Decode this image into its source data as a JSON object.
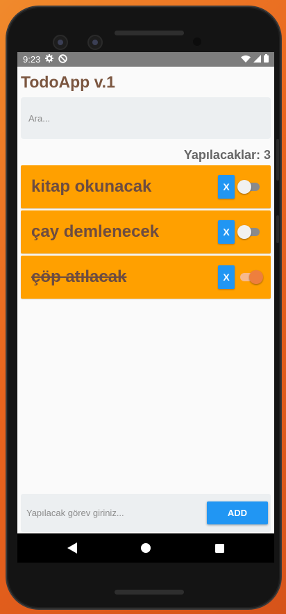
{
  "app": {
    "title": "TodoApp v.1",
    "search_placeholder": "Ara...",
    "count_label": "Yapılacaklar: 3"
  },
  "status_bar": {
    "time": "9:23"
  },
  "todos": [
    {
      "text": "kitap okunacak",
      "done": false,
      "delete_label": "X"
    },
    {
      "text": "çay demlenecek",
      "done": false,
      "delete_label": "X"
    },
    {
      "text": "çöp atılacak",
      "done": true,
      "delete_label": "X"
    }
  ],
  "add_bar": {
    "placeholder": "Yapılacak görev giriniz...",
    "button_label": "ADD"
  },
  "colors": {
    "accent": "#ffa000",
    "button": "#2196f3",
    "title": "#7b5640"
  },
  "icons": [
    "settings-icon",
    "do-not-disturb-icon",
    "wifi-icon",
    "signal-icon",
    "battery-icon",
    "back-icon",
    "home-icon",
    "recents-icon"
  ]
}
